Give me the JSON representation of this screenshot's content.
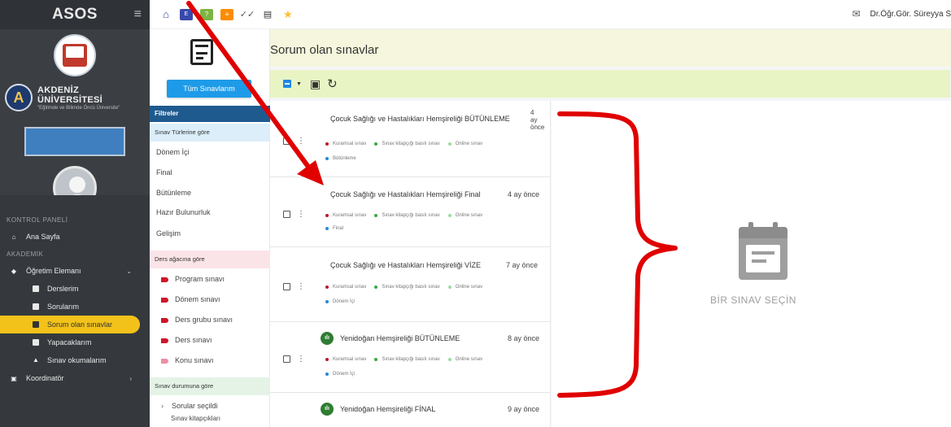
{
  "sidebar": {
    "app_name": "ASOS",
    "university": {
      "name": "AKDENİZ ÜNİVERSİTESİ",
      "motto": "\"Eğitimde ve Bilimde Öncü Üniversite\""
    },
    "sections": {
      "control_panel": "KONTROL PANELİ",
      "academic": "AKADEMİK"
    },
    "items": {
      "home": "Ana Sayfa",
      "instructor": "Öğretim Elemanı",
      "courses": "Derslerim",
      "questions": "Sorularım",
      "responsible_exams": "Sorum olan sınavlar",
      "todo": "Yapacaklarım",
      "exam_readings": "Sınav okumalarım",
      "coordinator": "Koordinatör"
    }
  },
  "topbar": {
    "user_name": "Dr.Öğr.Gör. Süreyya S"
  },
  "filters": {
    "all_button": "Tüm Sınavlarım",
    "header": "Filtreler",
    "by_type": "Sınav Türlerine göre",
    "types": [
      "Dönem İçi",
      "Final",
      "Bütünleme",
      "Hazır Bulunurluk",
      "Gelişim"
    ],
    "by_tree": "Ders ağacına göre",
    "tree": [
      "Program sınavı",
      "Dönem sınavı",
      "Ders grubu sınavı",
      "Ders sınavı",
      "Konu sınavı"
    ],
    "by_status": "Sınav durumuna göre",
    "status": [
      "Sorular seçildi",
      "Sınav kitapçıkları"
    ]
  },
  "main": {
    "title": "Sorum olan sınavlar",
    "empty_state": "BİR SINAV SEÇİN"
  },
  "tag_labels": {
    "theory": "Kuramsal sınav",
    "booklet": "Sınav kitapçığı basılı sınav",
    "online": "Online sınav"
  },
  "exams": [
    {
      "title": "Çocuk Sağlığı ve Hastalıkları Hemşireliği BÜTÜNLEME",
      "time": "4 ay önce",
      "term": "Bütünleme"
    },
    {
      "title": "Çocuk Sağlığı ve Hastalıkları Hemşireliği Final",
      "time": "4 ay önce",
      "term": "Final"
    },
    {
      "title": "Çocuk Sağlığı ve Hastalıkları Hemşireliği VİZE",
      "time": "7 ay önce",
      "term": "Dönem İçi"
    },
    {
      "title": "Yenidoğan Hemşireliği BÜTÜNLEME",
      "time": "8 ay önce",
      "term": "Dönem İçi"
    },
    {
      "title": "Yenidoğan Hemşireliği FİNAL",
      "time": "9 ay önce",
      "term": ""
    }
  ],
  "colors": {
    "sidebar": "#3b3f44",
    "accent_yellow": "#f2c21b",
    "primary_blue": "#1e9be8",
    "filter_header": "#1f5a8f",
    "annotation_red": "#e00000"
  }
}
